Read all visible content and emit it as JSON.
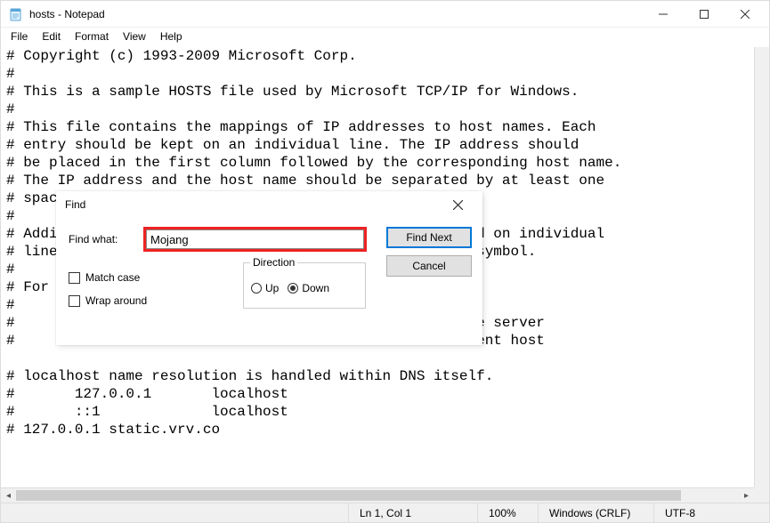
{
  "window": {
    "title": "hosts - Notepad"
  },
  "menu": {
    "items": [
      "File",
      "Edit",
      "Format",
      "View",
      "Help"
    ]
  },
  "editor": {
    "content": "# Copyright (c) 1993-2009 Microsoft Corp.\n#\n# This is a sample HOSTS file used by Microsoft TCP/IP for Windows.\n#\n# This file contains the mappings of IP addresses to host names. Each\n# entry should be kept on an individual line. The IP address should\n# be placed in the first column followed by the corresponding host name.\n# The IP address and the host name should be separated by at least one\n# space.\n#\n# Additionally, comments (such as these) may be inserted on individual\n# lines or following the machine name denoted by a '#' symbol.\n#\n# For example:\n#\n#      102.54.94.97     rhino.acme.com          # source server\n#       38.25.63.10     x.acme.com              # x client host\n\n# localhost name resolution is handled within DNS itself.\n#       127.0.0.1       localhost\n#       ::1             localhost\n# 127.0.0.1 static.vrv.co"
  },
  "status": {
    "position": "Ln 1, Col 1",
    "zoom": "100%",
    "line_ending": "Windows (CRLF)",
    "encoding": "UTF-8"
  },
  "find": {
    "title": "Find",
    "label_find_what": "Find what:",
    "value": "Mojang",
    "btn_find_next": "Find Next",
    "btn_cancel": "Cancel",
    "group_direction": "Direction",
    "radio_up": "Up",
    "radio_down": "Down",
    "direction_selected": "down",
    "check_match_case": "Match case",
    "check_wrap_around": "Wrap around",
    "match_case_checked": false,
    "wrap_around_checked": false
  }
}
